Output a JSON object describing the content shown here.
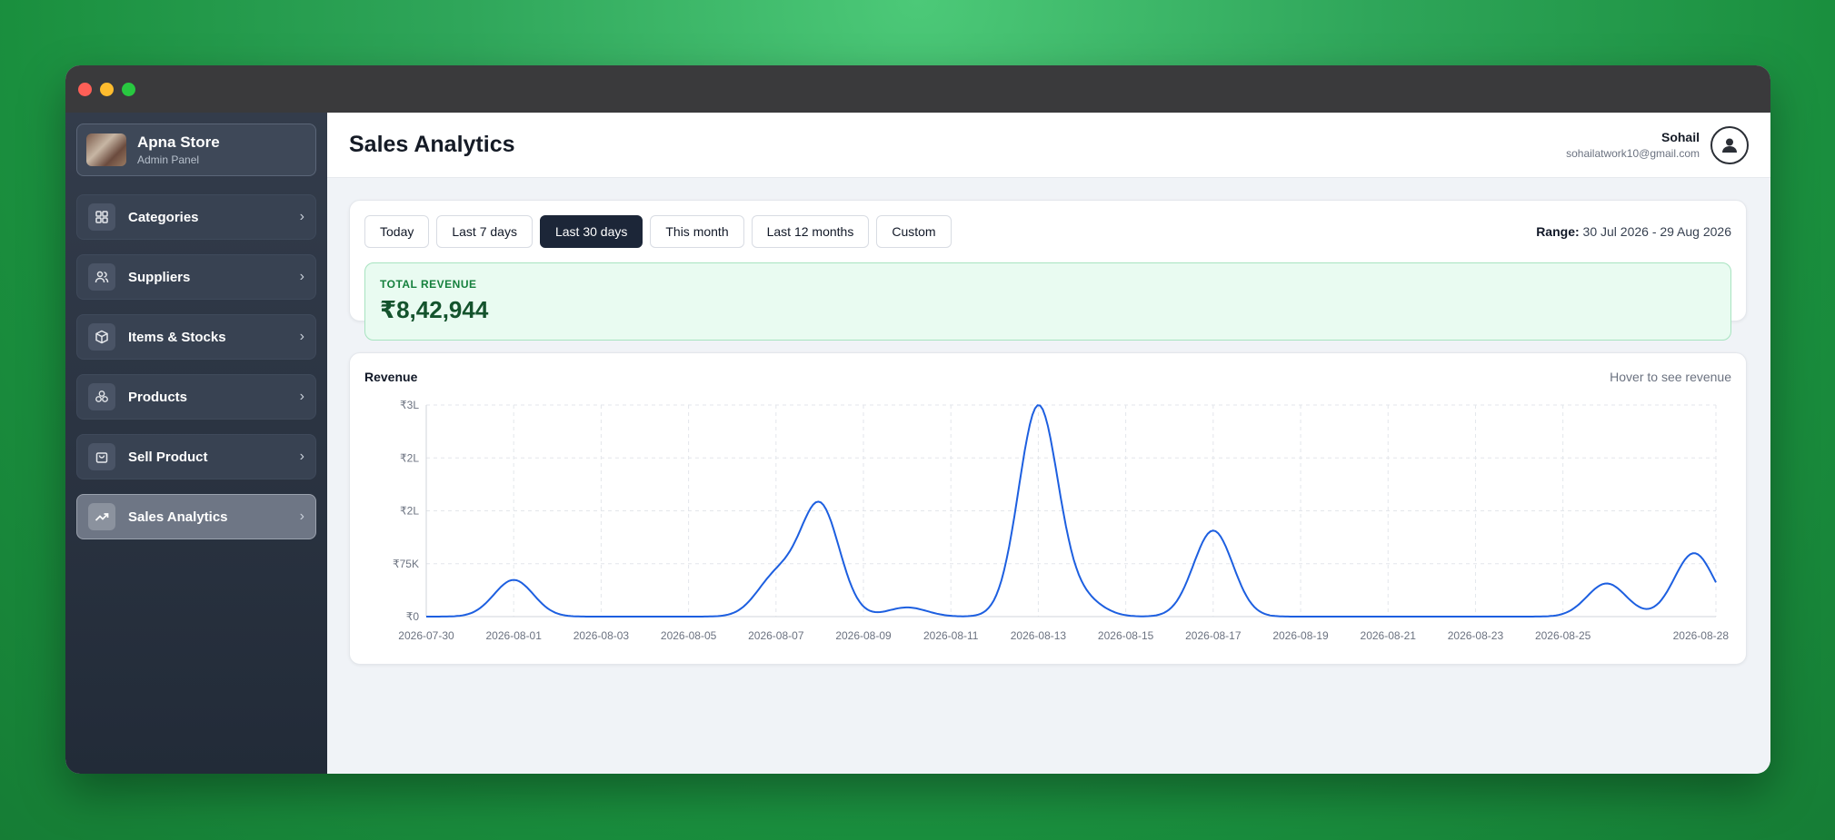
{
  "sidebar": {
    "brand": {
      "name": "Apna Store",
      "subtitle": "Admin Panel"
    },
    "items": [
      {
        "label": "Categories",
        "icon": "grid-icon"
      },
      {
        "label": "Suppliers",
        "icon": "users-icon"
      },
      {
        "label": "Items & Stocks",
        "icon": "box-icon"
      },
      {
        "label": "Products",
        "icon": "cubes-icon"
      },
      {
        "label": "Sell Product",
        "icon": "shopping-bag-icon"
      },
      {
        "label": "Sales Analytics",
        "icon": "trending-up-icon",
        "active": true
      }
    ]
  },
  "header": {
    "title": "Sales Analytics",
    "user": {
      "name": "Sohail",
      "email": "sohailatwork10@gmail.com"
    }
  },
  "filters": {
    "tabs": [
      "Today",
      "Last 7 days",
      "Last 30 days",
      "This month",
      "Last 12 months",
      "Custom"
    ],
    "active": "Last 30 days",
    "range_label": "Range:",
    "range_value": "30 Jul 2026 - 29 Aug 2026"
  },
  "summary": {
    "label": "TOTAL REVENUE",
    "value": "₹8,42,944"
  },
  "colors": {
    "accent": "#1d5fe0",
    "sidebar": "#2a3342",
    "active_tab": "#1c2638",
    "success_bg": "#e9fbf1"
  },
  "chart_data": {
    "type": "line",
    "title": "Revenue",
    "hint": "Hover to see revenue",
    "y_ticks": [
      "₹0",
      "₹75K",
      "₹2L",
      "₹2L",
      "₹3L"
    ],
    "x_ticks": [
      "2026-07-30",
      "2026-08-01",
      "2026-08-03",
      "2026-08-05",
      "2026-08-07",
      "2026-08-09",
      "2026-08-11",
      "2026-08-13",
      "2026-08-15",
      "2026-08-17",
      "2026-08-19",
      "2026-08-21",
      "2026-08-23",
      "2026-08-25",
      "2026-08-28"
    ],
    "ylim": [
      0,
      300000
    ],
    "grid": true,
    "series": [
      {
        "values": [
          {
            "x": "2026-08-01",
            "y": 52000
          },
          {
            "x": "2026-08-07",
            "y": 55000
          },
          {
            "x": "2026-08-08",
            "y": 158000
          },
          {
            "x": "2026-08-10",
            "y": 13000
          },
          {
            "x": "2026-08-13",
            "y": 298000
          },
          {
            "x": "2026-08-14",
            "y": 24000
          },
          {
            "x": "2026-08-17",
            "y": 122000
          },
          {
            "x": "2026-08-26",
            "y": 47000
          },
          {
            "x": "2026-08-28",
            "y": 90000
          }
        ]
      }
    ]
  }
}
